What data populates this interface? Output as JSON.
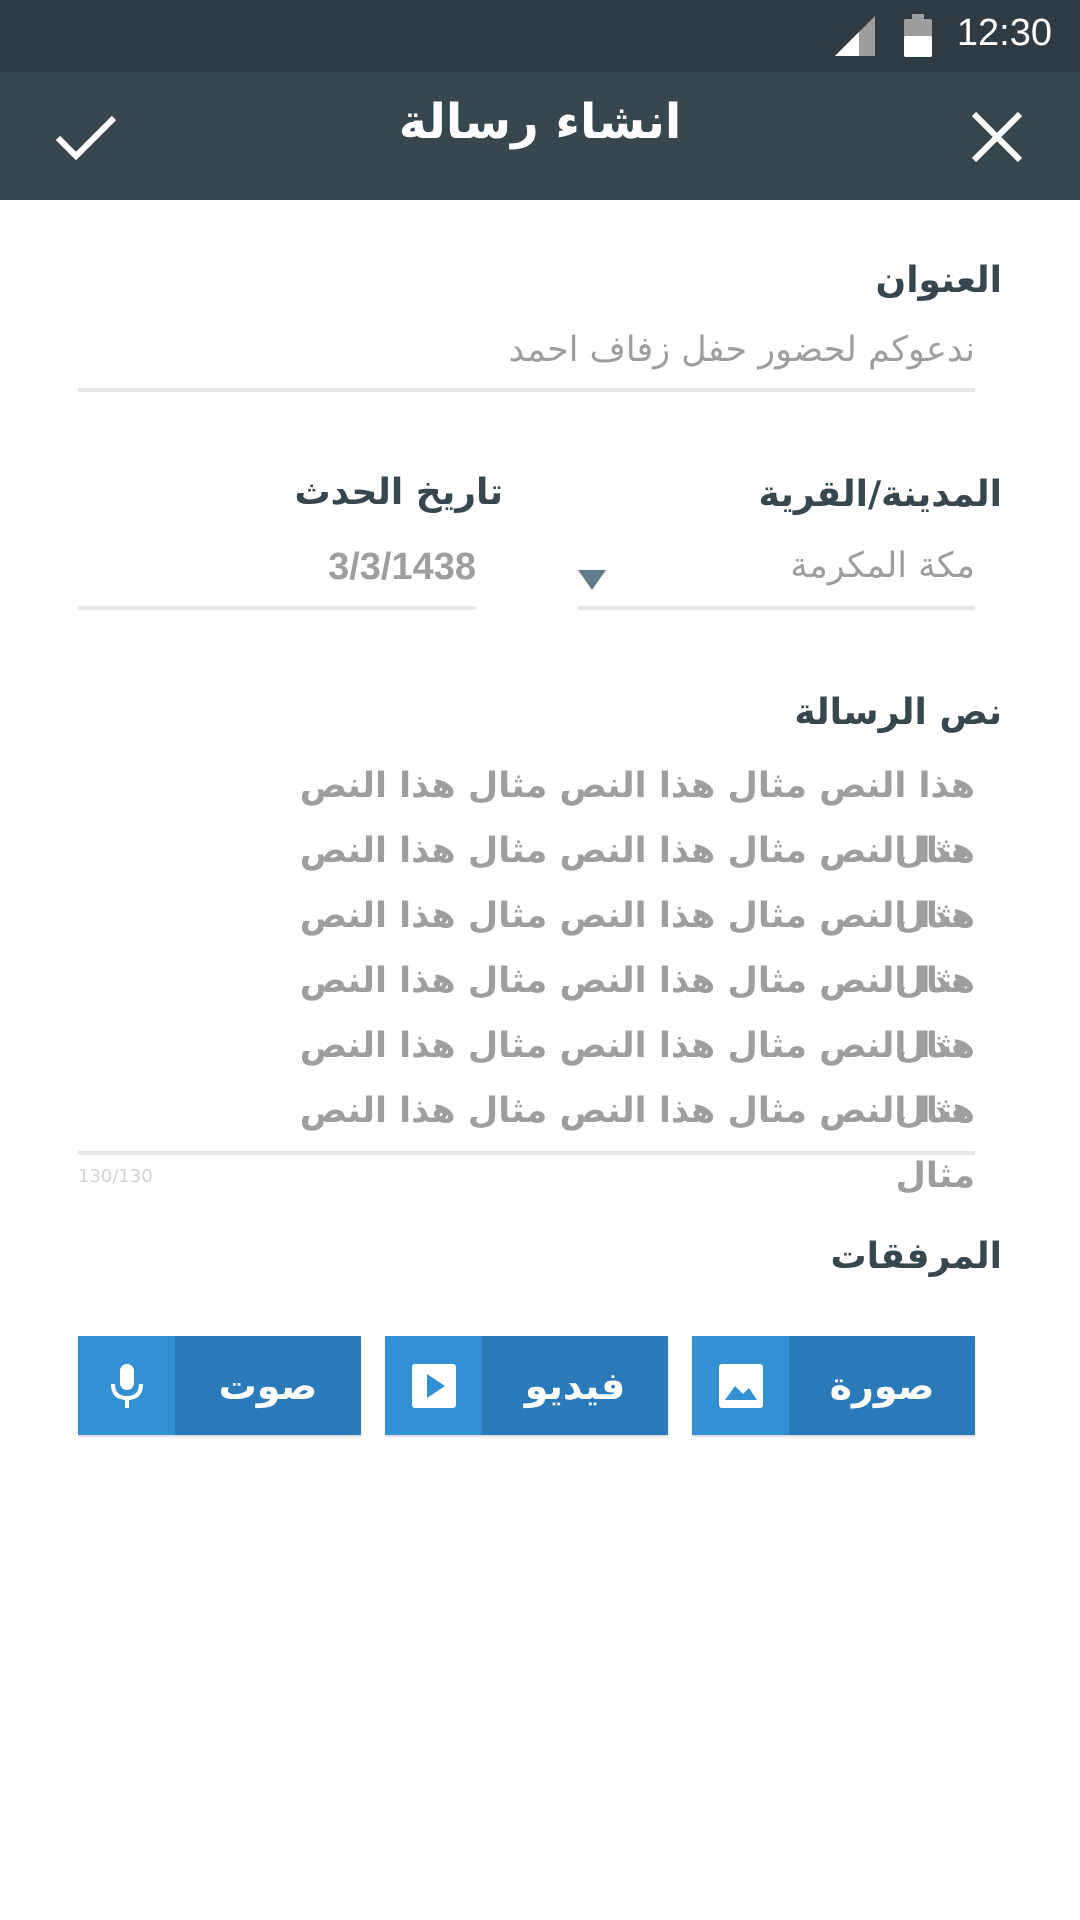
{
  "status_bar": {
    "time": "12:30",
    "signal_icon": "signal-icon",
    "battery_icon": "battery-icon"
  },
  "app_bar": {
    "title": "انشاء رسالة",
    "confirm_icon": "check-icon",
    "close_icon": "close-icon"
  },
  "form": {
    "subject": {
      "label": "العنوان",
      "value": "ندعوكم لحضور حفل زفاف احمد"
    },
    "city": {
      "label": "المدينة/القرية",
      "value": "مكة المكرمة"
    },
    "event_date": {
      "label": "تاريخ الحدث",
      "value": "3/3/1438"
    },
    "message": {
      "label": "نص الرسالة",
      "lines": [
        "هذا النص مثال هذا النص مثال هذا النص مثال",
        "هذا النص مثال هذا النص مثال هذا النص مثال",
        "هذا النص مثال هذا النص مثال هذا النص مثال",
        "هذا النص مثال هذا النص مثال هذا النص مثال",
        "هذا النص مثال هذا النص مثال هذا النص مثال",
        "هذا النص مثال هذا النص مثال هذا النص مثال"
      ],
      "counter": "130/130"
    }
  },
  "attachments": {
    "label": "المرفقات",
    "buttons": [
      {
        "label": "صورة",
        "icon": "image-icon"
      },
      {
        "label": "فيديو",
        "icon": "video-play-icon"
      },
      {
        "label": "صوت",
        "icon": "microphone-icon"
      }
    ]
  },
  "colors": {
    "status_bar": "#2e3b44",
    "app_bar": "#37474f",
    "button_dark": "#2b7ab9",
    "button_light": "#3390d3",
    "placeholder_text": "#9e9e9e"
  }
}
